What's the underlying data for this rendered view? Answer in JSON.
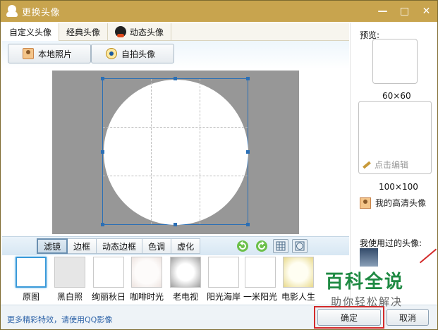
{
  "window": {
    "title": "更换头像",
    "controls": [
      "—",
      "□",
      "✕"
    ]
  },
  "tabs": [
    {
      "label": "自定义头像",
      "active": true
    },
    {
      "label": "经典头像",
      "active": false
    },
    {
      "label": "动态头像",
      "active": false
    }
  ],
  "toolbar": {
    "local_photo": "本地照片",
    "selfie": "自拍头像"
  },
  "filter_tabs": [
    {
      "label": "滤镜",
      "active": true
    },
    {
      "label": "边框",
      "active": false
    },
    {
      "label": "动态边框",
      "active": false
    },
    {
      "label": "色调",
      "active": false
    },
    {
      "label": "虚化",
      "active": false
    }
  ],
  "filter_tools": {
    "rotate_left": "↺",
    "rotate_right": "↻"
  },
  "filters": [
    {
      "label": "原图",
      "selected": true,
      "tint": "#ffffff"
    },
    {
      "label": "黑白照",
      "selected": false,
      "tint": "#e6e6e6"
    },
    {
      "label": "绚丽秋日",
      "selected": false,
      "tint": "#fcfcfc"
    },
    {
      "label": "咖啡时光",
      "selected": false,
      "tint": "#f6f1ef"
    },
    {
      "label": "老电视",
      "selected": false,
      "tint": "#d0d0d0"
    },
    {
      "label": "阳光海岸",
      "selected": false,
      "tint": "#fbfbfb"
    },
    {
      "label": "一米阳光",
      "selected": false,
      "tint": "#fdfdfd"
    },
    {
      "label": "电影人生",
      "selected": false,
      "tint": "#fbf3cc"
    }
  ],
  "bottom": {
    "hint": "更多精彩特效，请使用QQ影像",
    "ok": "确定",
    "cancel": "取消"
  },
  "right_panel": {
    "preview_label": "预览:",
    "size_small": "60×60",
    "size_large": "100×100",
    "edit_hint": "点击编辑",
    "hd_avatar": "我的高清头像",
    "used_label": "我使用过的头像:"
  },
  "watermark": {
    "main": "百科全说",
    "sub": "助你轻松解决"
  },
  "colors": {
    "titlebar": "#c8a44e",
    "accent": "#2b6fb5",
    "hint_link": "#2d63a8",
    "highlight_red": "#d32a2a",
    "watermark_green": "#1f8a43"
  }
}
